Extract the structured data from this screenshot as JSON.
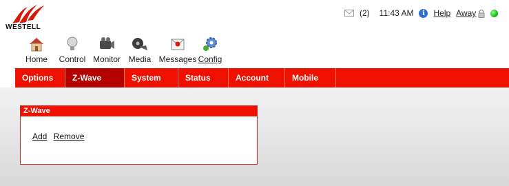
{
  "brand": {
    "name": "WESTELL"
  },
  "status": {
    "message_count": "(2)",
    "time": "11:43 AM",
    "help_label": "Help",
    "mode_label": "Away",
    "status_color": "#1ec31e"
  },
  "toolbar": {
    "items": [
      {
        "label": "Home",
        "icon": "home-icon"
      },
      {
        "label": "Control",
        "icon": "bulb-icon"
      },
      {
        "label": "Monitor",
        "icon": "camera-icon"
      },
      {
        "label": "Media",
        "icon": "film-icon"
      },
      {
        "label": "Messages",
        "icon": "message-icon"
      },
      {
        "label": "Config",
        "icon": "gear-icon",
        "active": true
      }
    ]
  },
  "nav": {
    "tabs": [
      {
        "label": "Options"
      },
      {
        "label": "Z-Wave",
        "active": true
      },
      {
        "label": "System"
      },
      {
        "label": "Status"
      },
      {
        "label": "Account"
      },
      {
        "label": "Mobile"
      }
    ]
  },
  "panel": {
    "title": "Z-Wave",
    "add_label": "Add",
    "remove_label": "Remove"
  },
  "colors": {
    "accent": "#ee1100",
    "active_tab": "#b50000"
  }
}
